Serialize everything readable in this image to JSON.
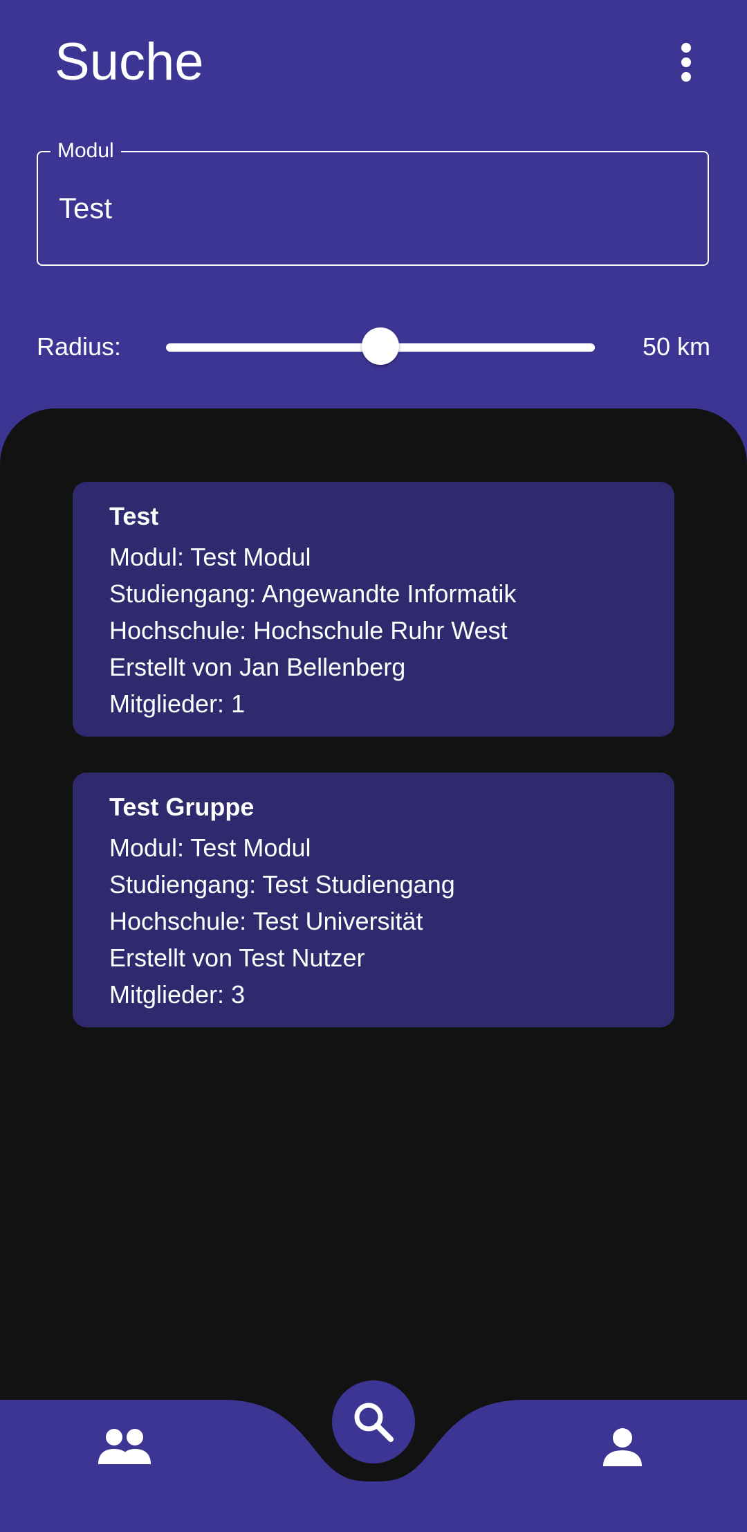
{
  "header": {
    "title": "Suche",
    "menu_icon": "more-vert-icon"
  },
  "module_field": {
    "label": "Modul",
    "value": "Test"
  },
  "radius": {
    "label": "Radius:",
    "value_text": "50 km",
    "slider_fraction": 0.5
  },
  "results": [
    {
      "title": "Test",
      "module": "Modul: Test Modul",
      "program": "Studiengang: Angewandte Informatik",
      "university": "Hochschule: Hochschule Ruhr West",
      "creator": "Erstellt von Jan Bellenberg",
      "members": "Mitglieder: 1"
    },
    {
      "title": "Test Gruppe",
      "module": "Modul: Test Modul",
      "program": "Studiengang: Test Studiengang",
      "university": "Hochschule: Test Universität",
      "creator": "Erstellt von Test Nutzer",
      "members": "Mitglieder: 3"
    }
  ],
  "bottom_nav": {
    "left_icon": "groups-icon",
    "center_icon": "search-icon",
    "right_icon": "person-icon"
  },
  "colors": {
    "primary": "#3c3593",
    "card": "#2f2a6d",
    "background": "#121212",
    "on_primary": "#ffffff"
  }
}
